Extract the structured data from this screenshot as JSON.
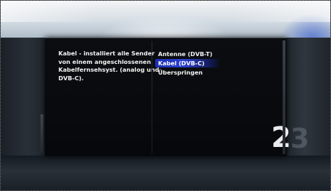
{
  "description": {
    "lines": [
      "Kabel - installiert alle Sender",
      "von einem angeschlossenen",
      "Kabelfernsehsyst. (analog und",
      "DVB-C)."
    ]
  },
  "options": [
    {
      "label": "Antenne (DVB-T)",
      "selected": false
    },
    {
      "label": "Kabel (DVB-C)",
      "selected": true
    },
    {
      "label": "Überspringen",
      "selected": false
    }
  ],
  "step": {
    "number": "2",
    "next_hint": "3"
  },
  "colors": {
    "selection": "#2c3fd0",
    "panel": "#06080b",
    "text": "#f2f2f2"
  }
}
